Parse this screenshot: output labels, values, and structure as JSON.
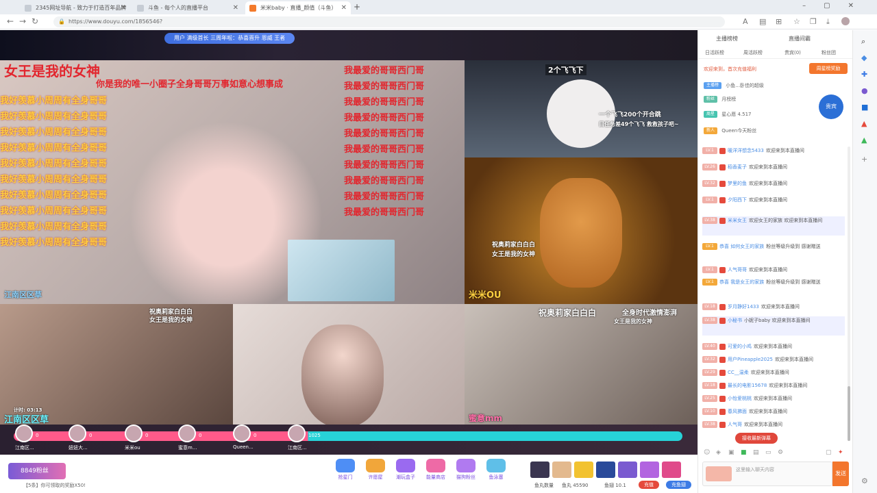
{
  "browser": {
    "tabs": [
      {
        "title": "2345网址导航 - 致力于打造百年品牌"
      },
      {
        "title": "斗鱼 - 每个人的直播平台"
      },
      {
        "title": "米米baby · 直播_颜值（斗鱼）"
      }
    ],
    "url": "https://www.douyu.com/1856546?",
    "new_tab": "+"
  },
  "stream": {
    "notice": "用户 满级首长 三周年啦：恭喜晋升 恩威 王者",
    "cell1": {
      "title_red": "女王是我的女神",
      "subtitle": "你是我的唯一小圈子全身哥哥万事如意心想事成",
      "left_lines": [
        "我好羡慕小周周有全身哥哥",
        "我好羡慕小周周有全身哥哥",
        "我好羡慕小周周有全身哥哥",
        "我好羡慕小周周有全身哥哥",
        "我好羡慕小周周有全身哥哥",
        "我好羡慕小周周有全身哥哥",
        "我好羡慕小周周有全身哥哥",
        "我好羡慕小周周有全身哥哥",
        "我好羡慕小周周有全身哥哥",
        "我好羡慕小周周有全身哥哥"
      ],
      "right_lines": [
        "我最爱的哥哥西门哥",
        "我最爱的哥哥西门哥",
        "我最爱的哥哥西门哥",
        "我最爱的哥哥西门哥",
        "我最爱的哥哥西门哥",
        "我最爱的哥哥西门哥",
        "我最爱的哥哥西门哥",
        "我最爱的哥哥西门哥",
        "我最爱的哥哥西门哥",
        "我最爱的哥哥西门哥"
      ],
      "bottom_label": "江南区区草"
    },
    "cell2": {
      "tag": "2个飞飞下",
      "line1": "一个飞飞200个开合跳",
      "line2": "目任务差49个飞飞 救救孩子吧~"
    },
    "cell3": {
      "caption": "祝奥莉家白白白",
      "caption2": "女王是我的女神",
      "bottom_label": "米米OU"
    },
    "cell4": {
      "caption": "祝奥莉家白白白",
      "caption2": "女王是我的女神",
      "timer": "计时: 03:13",
      "bottom_label": "江南区区草"
    },
    "cell6": {
      "caption": "祝奥莉家白白白",
      "caption2": "全身时代激情澎湃",
      "caption3": "女王是我的女神",
      "bottom_label": "蜜意mm"
    },
    "anchors": [
      {
        "name": "江南区...",
        "score": "0"
      },
      {
        "name": "妞妞大...",
        "score": "0"
      },
      {
        "name": "米米ou",
        "score": "0"
      },
      {
        "name": "蜜意m...",
        "score": "0"
      },
      {
        "name": "Queen...",
        "score": "0"
      },
      {
        "name": "江南区...",
        "score": "1025"
      }
    ]
  },
  "bottom": {
    "fans_badge": "8849粉丝",
    "gift_buttons": [
      {
        "label": "抢星门"
      },
      {
        "label": "许愿屋"
      },
      {
        "label": "潮玩盒子"
      },
      {
        "label": "能量商店"
      },
      {
        "label": "猫狗粉丝"
      },
      {
        "label": "鱼泳塞"
      }
    ],
    "status_left": "【5条】你可领取的奖励X50!",
    "stat_1": "鱼丸数量",
    "stat_2": "鱼丸 45590",
    "stat_3": "鱼翅 10.1",
    "red_pill": "充值",
    "blue_pill": "充鱼翅"
  },
  "sidebar": {
    "rank_tabs": [
      "主播榜榜",
      "直播间霸"
    ],
    "sub_tabs": [
      "日活跃榜",
      "周活跃榜",
      "贵宾(0)",
      "粉丝团"
    ],
    "welcome": "欢迎来到，首次充值福利",
    "header_button": "周星榜奖励",
    "top_rows": [
      {
        "badge": "主播榜",
        "text": "小鱼...卧佳的超级"
      },
      {
        "badge": "粉丝",
        "text": "月榜榜"
      },
      {
        "badge": "周星",
        "text": "星心愿 4.517"
      },
      {
        "badge": "新人",
        "text": "Queen今天粉丝"
      }
    ],
    "noble_card": "贵宾",
    "messages": [
      {
        "level": "LV.1",
        "user": "暖洋洋想念5433",
        "text": "欢迎来到本直播间"
      },
      {
        "level": "LV.26",
        "user": "稻香麦子",
        "text": "欢迎来到本直播间"
      },
      {
        "level": "LV.32",
        "user": "梦里的鱼",
        "text": "欢迎来到本直播间"
      },
      {
        "level": "LV.1",
        "user": "夕阳西下",
        "text": "欢迎来到本直播间"
      },
      {
        "level": "LV.38",
        "user": "米米女王",
        "text": "欢迎女王的家族 欢迎来到本直播间"
      },
      {
        "level": "LV.1",
        "user": "恭喜 如何女王的家族",
        "text": "粉丝等级升级到 感谢赠送"
      },
      {
        "level": "LV.1",
        "user": "人气哥哥",
        "text": "欢迎来到本直播间"
      },
      {
        "level": "LV.1",
        "user": "恭喜 我是女王的家族",
        "text": "粉丝等级升级到 感谢赠送"
      },
      {
        "level": "LV.18",
        "user": "岁月静好1433",
        "text": "欢迎来到本直播间"
      },
      {
        "level": "LV.38",
        "user": "小秘书",
        "text": "小妮子baby 欢迎来到本直播间"
      },
      {
        "level": "LV.40",
        "user": "可爱的小鸡",
        "text": "欢迎来到本直播间"
      },
      {
        "level": "LV.32",
        "user": "用户Pineapple2025",
        "text": "欢迎来到本直播间"
      },
      {
        "level": "LV.29",
        "user": "CC__温柔",
        "text": "欢迎来到本直播间"
      },
      {
        "level": "LV.18",
        "user": "最长的电影15678",
        "text": "欢迎来到本直播间"
      },
      {
        "level": "LV.25",
        "user": "小怡爱桃桃",
        "text": "欢迎来到本直播间"
      },
      {
        "level": "LV.10",
        "user": "春风拂面",
        "text": "欢迎来到本直播间"
      },
      {
        "level": "LV.38",
        "user": "人气哥",
        "text": "欢迎来到本直播间"
      }
    ],
    "float_button": "接收最新弹幕",
    "chat_placeholder": "这里输入聊天内容",
    "send_label": "发送"
  }
}
